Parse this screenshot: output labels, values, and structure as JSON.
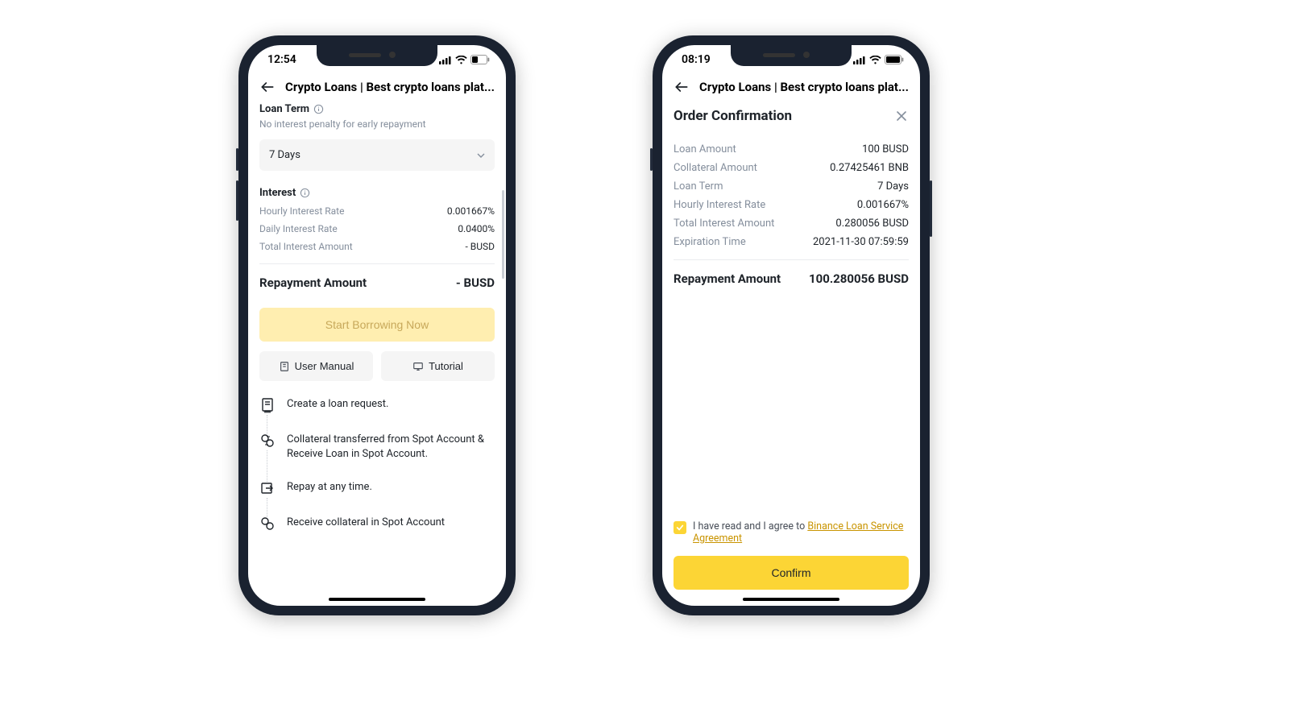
{
  "shared": {
    "nav_title": "Crypto Loans | Best crypto loans plat..."
  },
  "left": {
    "status_time": "12:54",
    "battery_level": "low",
    "section_loan_term": "Loan Term",
    "loan_term_sub": "No interest penalty for early repayment",
    "loan_term_value": "7 Days",
    "section_interest": "Interest",
    "hourly_rate_label": "Hourly Interest Rate",
    "hourly_rate_value": "0.001667%",
    "daily_rate_label": "Daily Interest Rate",
    "daily_rate_value": "0.0400%",
    "total_interest_label": "Total Interest Amount",
    "total_interest_value": "- BUSD",
    "repay_label": "Repayment Amount",
    "repay_value": "- BUSD",
    "btn_start": "Start Borrowing Now",
    "btn_manual": "User Manual",
    "btn_tutorial": "Tutorial",
    "steps": [
      "Create a loan request.",
      "Collateral transferred from Spot Account & Receive Loan in Spot Account.",
      "Repay at any time.",
      "Receive collateral in Spot Account"
    ]
  },
  "right": {
    "status_time": "08:19",
    "battery_level": "full",
    "title": "Order Confirmation",
    "rows": [
      {
        "l": "Loan Amount",
        "v": "100 BUSD"
      },
      {
        "l": "Collateral Amount",
        "v": "0.27425461 BNB"
      },
      {
        "l": "Loan Term",
        "v": "7 Days"
      },
      {
        "l": "Hourly Interest Rate",
        "v": "0.001667%"
      },
      {
        "l": "Total Interest Amount",
        "v": "0.280056 BUSD"
      },
      {
        "l": "Expiration Time",
        "v": "2021-11-30 07:59:59"
      }
    ],
    "repay_label": "Repayment Amount",
    "repay_value": "100.280056 BUSD",
    "agree_prefix": "I have read and I agree to ",
    "agree_link": "Binance Loan Service Agreement",
    "btn_confirm": "Confirm"
  }
}
